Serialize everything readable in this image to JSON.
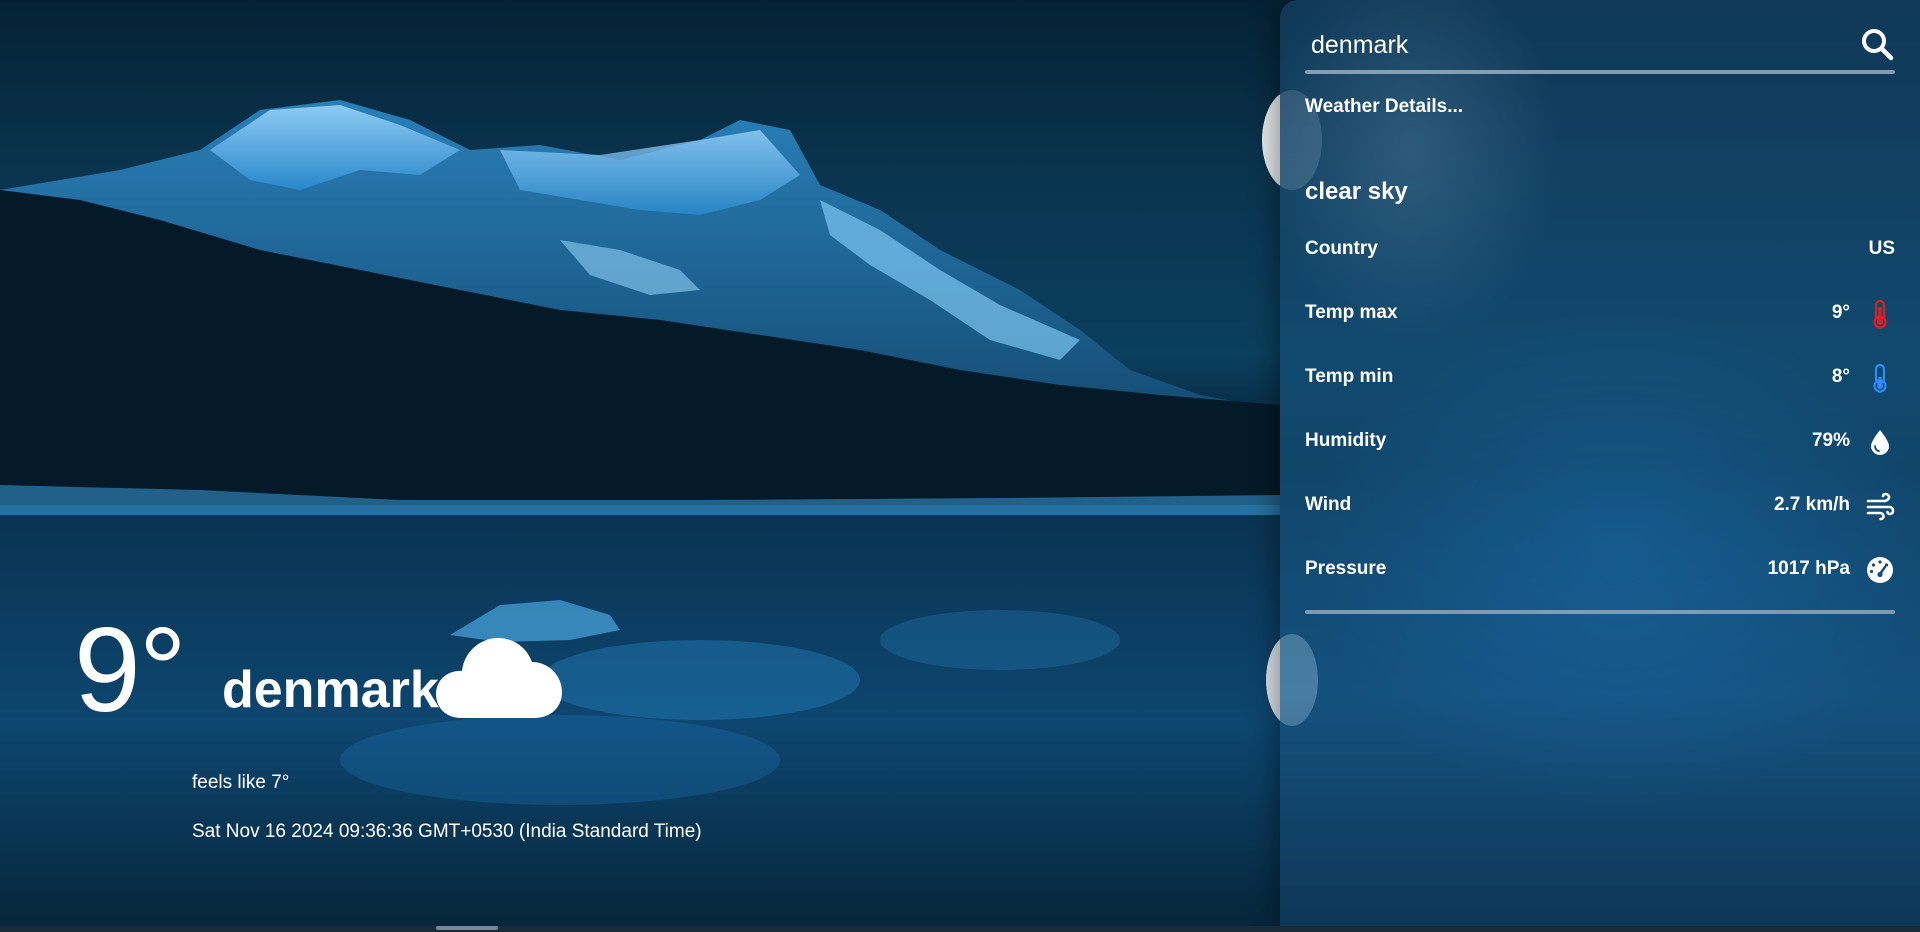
{
  "current": {
    "temp": "9°",
    "city": "denmark",
    "weather_icon": "cloud-icon",
    "feels_like": "feels like 7°",
    "datetime": "Sat Nov 16 2024 09:36:36 GMT+0530 (India Standard Time)"
  },
  "search": {
    "value": "denmark",
    "icon": "search-icon"
  },
  "details": {
    "heading": "Weather Details...",
    "condition": "clear sky",
    "rows": [
      {
        "label": "Country",
        "value": "US"
      },
      {
        "label": "Temp max",
        "value": "9°",
        "icon": "thermometer-hot-icon",
        "icon_color": "#e02020"
      },
      {
        "label": "Temp min",
        "value": "8°",
        "icon": "thermometer-cold-icon",
        "icon_color": "#2f8cff"
      },
      {
        "label": "Humidity",
        "value": "79%",
        "icon": "droplet-icon"
      },
      {
        "label": "Wind",
        "value": "2.7 km/h",
        "icon": "wind-icon"
      },
      {
        "label": "Pressure",
        "value": "1017 hPa",
        "icon": "gauge-icon"
      }
    ]
  },
  "colors": {
    "background": "#0b3f5e",
    "panel": "#144e76",
    "text": "#ffffff"
  }
}
